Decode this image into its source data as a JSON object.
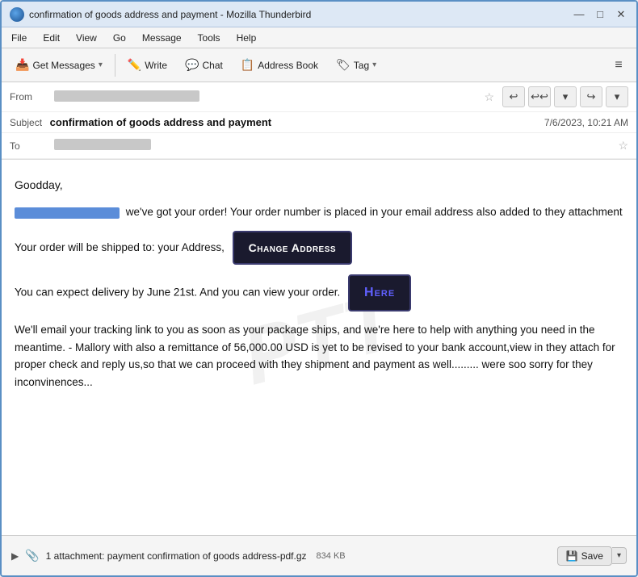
{
  "titleBar": {
    "title": "confirmation of goods address and payment - Mozilla Thunderbird",
    "controls": {
      "minimize": "—",
      "maximize": "□",
      "close": "✕"
    }
  },
  "menuBar": {
    "items": [
      "File",
      "Edit",
      "View",
      "Go",
      "Message",
      "Tools",
      "Help"
    ]
  },
  "toolbar": {
    "getMessages": "Get Messages",
    "write": "Write",
    "chat": "Chat",
    "addressBook": "Address Book",
    "tag": "Tag",
    "hamburger": "≡"
  },
  "emailHeader": {
    "fromLabel": "From",
    "subjectLabel": "Subject",
    "toLabel": "To",
    "subject": "confirmation of goods address and payment",
    "date": "7/6/2023, 10:21 AM"
  },
  "emailBody": {
    "greeting": "Goodday,",
    "para1_suffix": " we've got your order! Your order number is placed in your email address also added to they attachment",
    "para2_prefix": "Your order will be shipped to: your Address,",
    "changeAddressBtn": "Change Address",
    "para3_prefix": "You can expect delivery by June 21st. And you can view your order.",
    "hereBtn": "Here",
    "para4": "We'll email your tracking link to you as soon as your package ships, and we're here to help with anything you need in the meantime. - Mallory with also a remittance of 56,000.00 USD is yet to be revised to your bank account,view in they attach for proper check and reply us,so that we  can proceed with they shipment and payment as well......... were soo sorry for they inconvinences...",
    "watermark": "PTT"
  },
  "attachment": {
    "label": "1 attachment: payment confirmation of goods address-pdf.gz",
    "size": "834 KB",
    "saveBtn": "Save"
  }
}
